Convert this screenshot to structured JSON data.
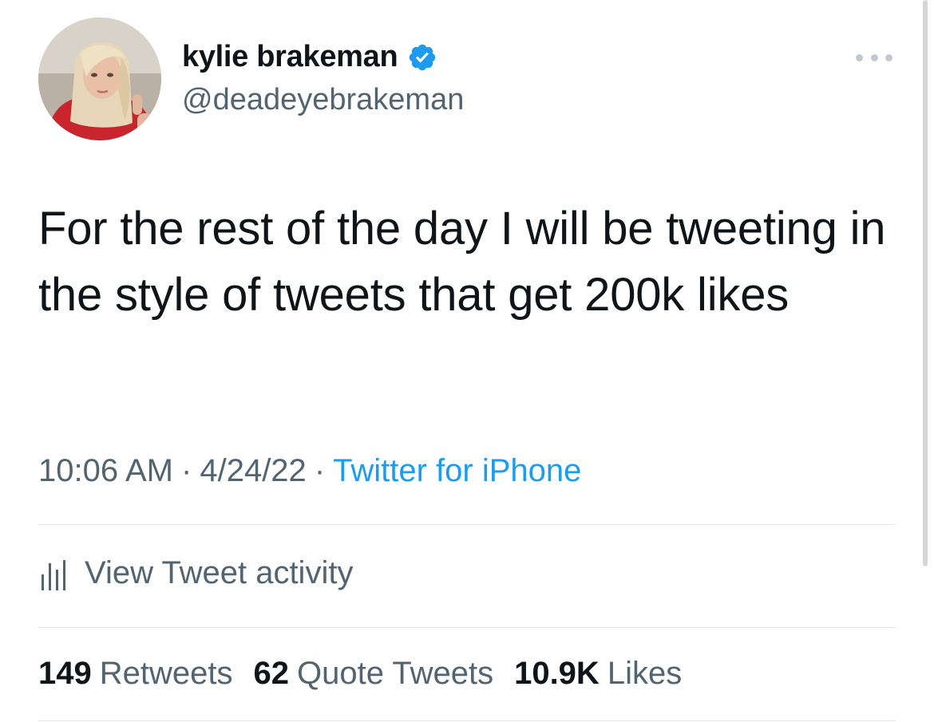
{
  "user": {
    "display_name": "kylie brakeman",
    "handle": "@deadeyebrakeman",
    "verified_icon": "verified-badge-icon",
    "verified_color": "#1d9bf0"
  },
  "tweet": {
    "text": "For the rest of the day I will be tweeting in the style of tweets that get 200k likes"
  },
  "meta": {
    "time": "10:06 AM",
    "separator": "·",
    "date": "4/24/22",
    "source": "Twitter for iPhone"
  },
  "activity": {
    "icon": "analytics-bars-icon",
    "label": "View Tweet activity"
  },
  "stats": {
    "retweets_count": "149",
    "retweets_label": "Retweets",
    "quotes_count": "62",
    "quotes_label": "Quote Tweets",
    "likes_count": "10.9K",
    "likes_label": "Likes"
  },
  "colors": {
    "text_primary": "#0f1419",
    "text_secondary": "#536471",
    "link": "#1d9bf0",
    "divider": "#e3e6e9"
  }
}
